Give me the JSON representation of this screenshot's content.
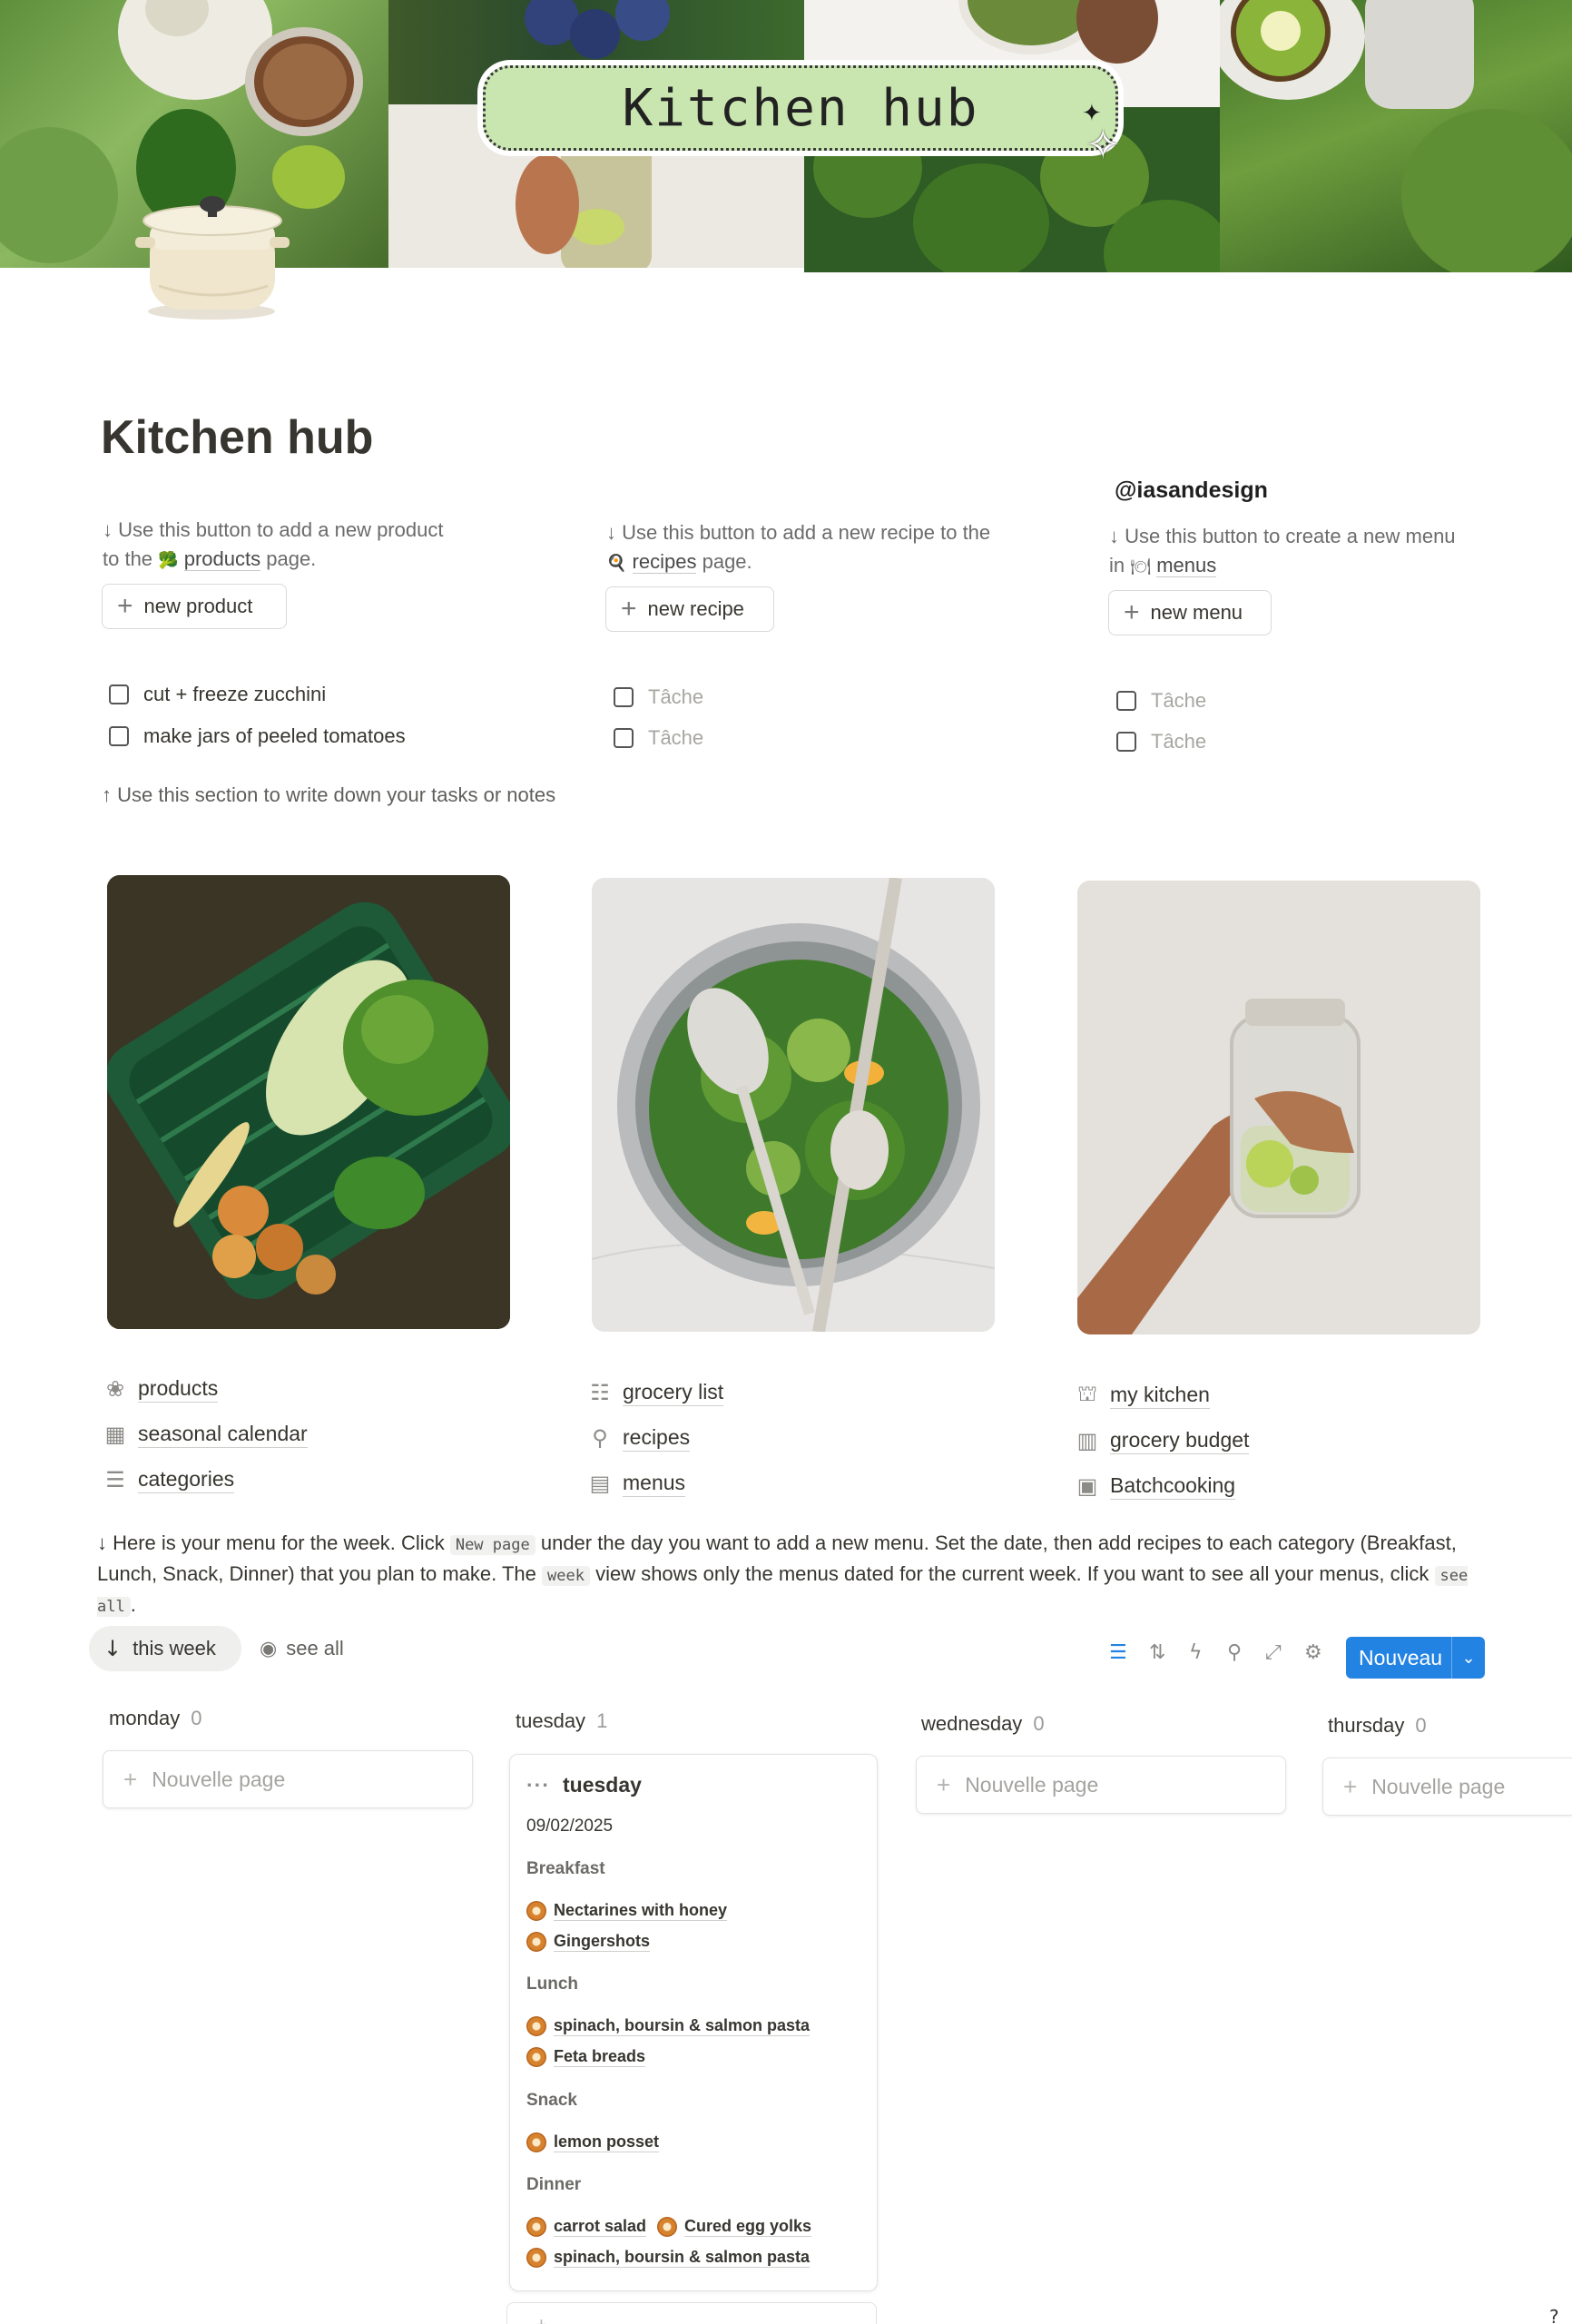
{
  "cover": {
    "title": "Kitchen hub"
  },
  "page": {
    "title": "Kitchen hub",
    "handle": "@iasandesign"
  },
  "columns": [
    {
      "hint_prefix": "↓ Use this button to add a new product",
      "hint_line2_prefix": "to the",
      "hint_link_icon": "🥦",
      "hint_link": "products",
      "hint_suffix": "page.",
      "button_label": "new product",
      "todos": [
        {
          "label": "cut + freeze zucchini",
          "checked": false
        },
        {
          "label": "make jars of peeled tomatoes",
          "checked": false
        }
      ]
    },
    {
      "hint_prefix": "↓ Use this button to add a new recipe to the",
      "hint_link_icon": "🍳",
      "hint_link": "recipes",
      "hint_suffix": "page.",
      "button_label": "new recipe",
      "todos": [
        {
          "label": "Tâche",
          "checked": false
        },
        {
          "label": "Tâche",
          "checked": false
        }
      ]
    },
    {
      "hint_prefix": "↓ Use this button to create a new menu",
      "hint_line2_prefix": "in",
      "hint_link_icon": "🍽",
      "hint_link": "menus",
      "button_label": "new menu",
      "todos": [
        {
          "label": "Tâche",
          "checked": false
        },
        {
          "label": "Tâche",
          "checked": false
        }
      ]
    }
  ],
  "tasks_note": "↑ Use this section to write down your tasks or notes",
  "links": [
    [
      {
        "label": "products",
        "icon": "broccoli-icon"
      },
      {
        "label": "seasonal calendar",
        "icon": "calendar-icon"
      },
      {
        "label": "categories",
        "icon": "list-icon"
      }
    ],
    [
      {
        "label": "grocery list",
        "icon": "checklist-icon"
      },
      {
        "label": "recipes",
        "icon": "search-recipe-icon"
      },
      {
        "label": "menus",
        "icon": "calendar-icon"
      }
    ],
    [
      {
        "label": "my kitchen",
        "icon": "basket-icon"
      },
      {
        "label": "grocery budget",
        "icon": "receipt-icon"
      },
      {
        "label": "Batchcooking",
        "icon": "lunchbox-icon"
      }
    ]
  ],
  "menu_intro": {
    "part1": "↓ Here is your menu for the week. Click",
    "code1": "New page",
    "part2": "under the day you want to add a new menu. Set the date, then add recipes to each category (Breakfast, Lunch, Snack, Dinner) that you plan to make. The",
    "code2": "week",
    "part3": "view shows only the menus dated for the current week. If you want to see all your menus, click",
    "code3": "see all",
    "part4": "."
  },
  "views": {
    "active": "this week",
    "other": "see all"
  },
  "toolbar": {
    "new_label": "Nouveau",
    "accent": "#2383e2"
  },
  "board": {
    "new_page_label": "Nouvelle page",
    "columns": [
      {
        "name": "monday",
        "count": "0"
      },
      {
        "name": "tuesday",
        "count": "1"
      },
      {
        "name": "wednesday",
        "count": "0"
      },
      {
        "name": "thursday",
        "count": "0"
      }
    ],
    "card": {
      "title": "tuesday",
      "date": "09/02/2025",
      "sections": [
        {
          "name": "Breakfast",
          "items": [
            "Nectarines with honey",
            "Gingershots"
          ]
        },
        {
          "name": "Lunch",
          "items": [
            "spinach, boursin & salmon pasta",
            "Feta breads"
          ]
        },
        {
          "name": "Snack",
          "items": [
            "lemon posset"
          ]
        },
        {
          "name": "Dinner",
          "items": [
            "carrot salad",
            "Cured egg yolks",
            "spinach, boursin & salmon pasta"
          ]
        }
      ]
    },
    "ghost_label": "Nouvelle page"
  }
}
